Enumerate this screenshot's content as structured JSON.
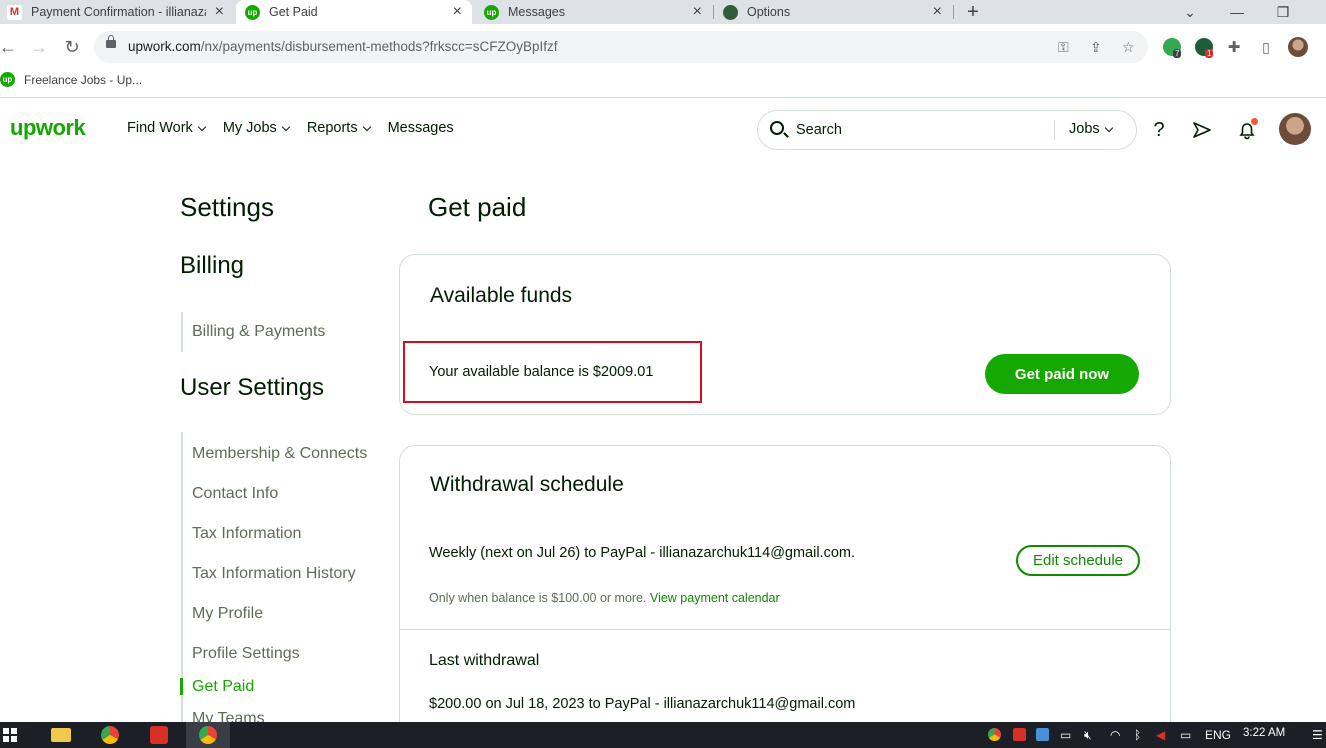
{
  "browser": {
    "tabs": [
      {
        "title": "Payment Confirmation - illianazar",
        "favicon": "gmail-icon",
        "active": false
      },
      {
        "title": "Get Paid",
        "favicon": "upwork-icon",
        "active": true
      },
      {
        "title": "Messages",
        "favicon": "upwork-icon",
        "active": false
      },
      {
        "title": "Options",
        "favicon": "extension-icon",
        "active": false
      }
    ],
    "new_tab": "+",
    "url_domain": "upwork.com",
    "url_path": "/nx/payments/disbursement-methods?frkscc=sCFZOyBpIfzf",
    "bookmark": "Freelance Jobs - Up...",
    "extension_badges": [
      "7",
      "1"
    ]
  },
  "header": {
    "logo": "upwork",
    "nav": [
      "Find Work",
      "My Jobs",
      "Reports",
      "Messages"
    ],
    "search_placeholder": "Search",
    "search_scope": "Jobs",
    "help_glyph": "?"
  },
  "sidebar": {
    "settings_title": "Settings",
    "billing_title": "Billing",
    "billing_items": [
      "Billing & Payments"
    ],
    "user_settings_title": "User Settings",
    "user_items": [
      "Membership & Connects",
      "Contact Info",
      "Tax Information",
      "Tax Information History",
      "My Profile",
      "Profile Settings",
      "Get Paid",
      "My Teams"
    ],
    "active_item": "Get Paid"
  },
  "main": {
    "page_title": "Get paid",
    "available_funds": {
      "title": "Available funds",
      "balance_prefix": "Your available balance is ",
      "balance_amount": "$2009.01",
      "button": "Get paid now"
    },
    "withdrawal_schedule": {
      "title": "Withdrawal schedule",
      "schedule": "Weekly (next on Jul 26) to PayPal - illianazarchuk114@gmail.com.",
      "note": "Only when balance is $100.00 or more. ",
      "note_link": "View payment calendar",
      "button": "Edit schedule"
    },
    "last_withdrawal": {
      "title": "Last withdrawal",
      "text": "$200.00 on Jul 18, 2023 to PayPal - illianazarchuk114@gmail.com"
    }
  },
  "taskbar": {
    "language": "ENG",
    "time": "3:22 AM"
  },
  "colors": {
    "brand_green": "#14a800",
    "link_green": "#108a00",
    "highlight_red": "#d4101e"
  }
}
